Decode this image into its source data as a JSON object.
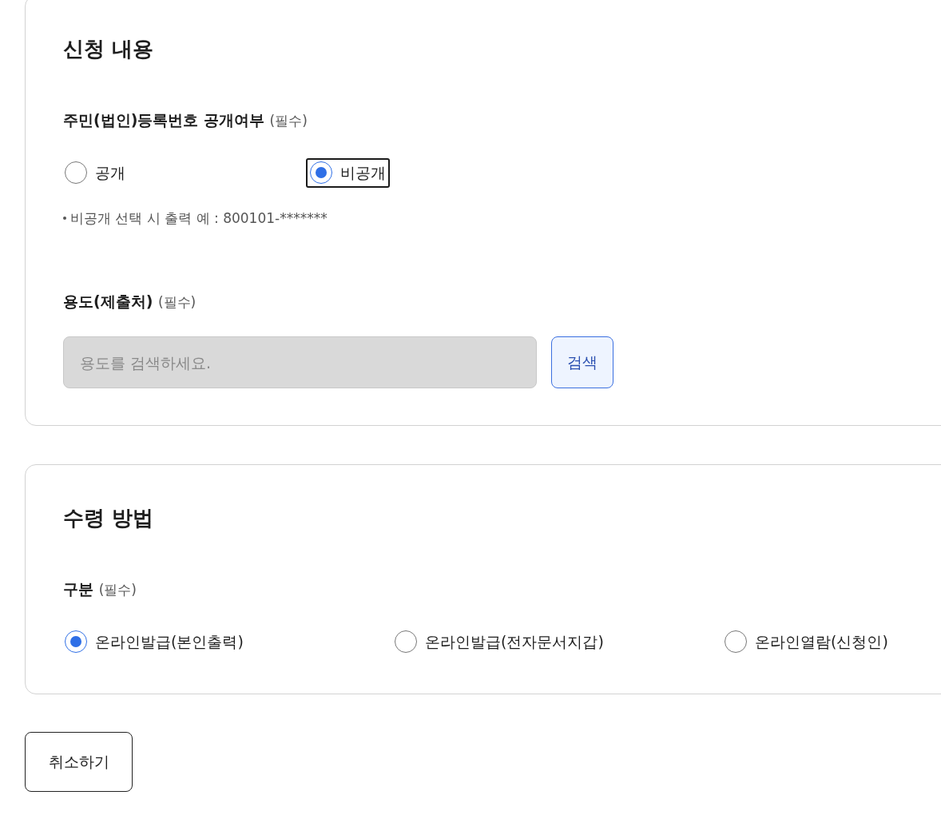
{
  "sections": [
    {
      "title": "신청 내용",
      "fields": [
        {
          "kind": "radio",
          "label": "주민(법인)등록번호 공개여부",
          "required": "(필수)",
          "options": [
            {
              "label": "공개",
              "selected": false,
              "focused": false
            },
            {
              "label": "비공개",
              "selected": true,
              "focused": true
            }
          ],
          "note": "비공개 선택 시 출력 예 : 800101-*******"
        },
        {
          "kind": "search",
          "label": "용도(제출처)",
          "required": "(필수)",
          "placeholder": "용도를 검색하세요.",
          "button": "검색"
        }
      ]
    },
    {
      "title": "수령 방법",
      "fields": [
        {
          "kind": "radio",
          "label": "구분",
          "required": "(필수)",
          "options": [
            {
              "label": "온라인발급(본인출력)",
              "selected": true,
              "focused": false
            },
            {
              "label": "온라인발급(전자문서지갑)",
              "selected": false,
              "focused": false
            },
            {
              "label": "온라인열람(신청인)",
              "selected": false,
              "focused": false
            }
          ]
        }
      ]
    }
  ],
  "cancel_button": "취소하기"
}
